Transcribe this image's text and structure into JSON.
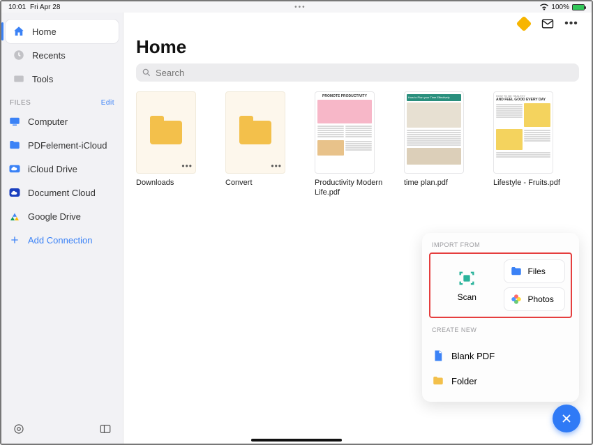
{
  "status": {
    "time": "10:01",
    "date": "Fri Apr 28",
    "battery": "100%"
  },
  "header": {
    "title": "Home"
  },
  "search": {
    "placeholder": "Search"
  },
  "sidebar": {
    "main": [
      {
        "label": "Home"
      },
      {
        "label": "Recents"
      },
      {
        "label": "Tools"
      }
    ],
    "files_header": "FILES",
    "edit_label": "Edit",
    "files": [
      {
        "label": "Computer"
      },
      {
        "label": "PDFelement-iCloud"
      },
      {
        "label": "iCloud Drive"
      },
      {
        "label": "Document Cloud"
      },
      {
        "label": "Google Drive"
      }
    ],
    "add_connection": "Add Connection"
  },
  "grid": [
    {
      "label": "Downloads",
      "type": "folder"
    },
    {
      "label": "Convert",
      "type": "folder"
    },
    {
      "label": "Productivity Modern Life.pdf",
      "type": "doc",
      "headline": "PROMOTE PRODUCTIVITY"
    },
    {
      "label": "time plan.pdf",
      "type": "doc",
      "headline": "How to Plan your Time Effectively"
    },
    {
      "label": "Lifestyle - Fruits.pdf",
      "type": "doc",
      "headline": "AND FEEL GOOD EVERY DAY"
    }
  ],
  "popover": {
    "import_label": "IMPORT FROM",
    "scan_label": "Scan",
    "files_label": "Files",
    "photos_label": "Photos",
    "create_label": "CREATE NEW",
    "blank_pdf": "Blank PDF",
    "folder": "Folder"
  }
}
